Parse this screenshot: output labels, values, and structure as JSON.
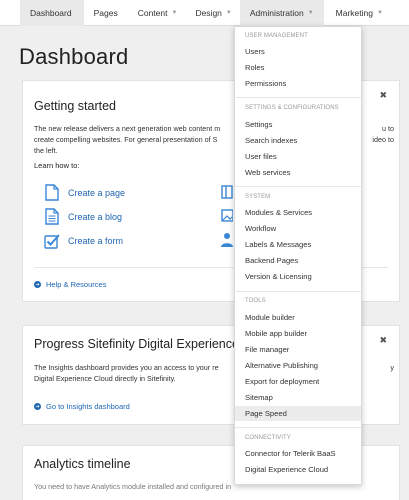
{
  "nav": {
    "dashboard": "Dashboard",
    "pages": "Pages",
    "content": "Content",
    "design": "Design",
    "administration": "Administration",
    "marketing": "Marketing"
  },
  "page_title": "Dashboard",
  "getting_started": {
    "title": "Getting started",
    "description": "The new release delivers a next generation web content m... you to create compelling websites. For general presentation of S... video to the left.",
    "desc_line1": "The new release delivers a next generation web content m",
    "desc_line1_end": "u to",
    "desc_line2": "create compelling websites. For general presentation of S",
    "desc_line2_end": "ideo to",
    "desc_line3": "the left.",
    "learn_how": "Learn how to:",
    "links": [
      "Create a page",
      "Create a blog",
      "Create a form"
    ],
    "help": "Help & Resources"
  },
  "progress": {
    "title": "Progress Sitefinity Digital Experience Clou",
    "desc_line1": "The Insights dashboard provides you an access to your re",
    "desc_line1_end": "y",
    "desc_line2": "Digital Experience Cloud directly in Sitefinity.",
    "link": "Go to Insights dashboard"
  },
  "analytics": {
    "title": "Analytics timeline",
    "desc": "You need to have Analytics module installed and configured in"
  },
  "admin_menu": {
    "user_management": {
      "heading": "USER MANAGEMENT",
      "items": [
        "Users",
        "Roles",
        "Permissions"
      ]
    },
    "settings": {
      "heading": "SETTINGS & CONFIGURATIONS",
      "items": [
        "Settings",
        "Search indexes",
        "User files",
        "Web services"
      ]
    },
    "system": {
      "heading": "SYSTEM",
      "items": [
        "Modules & Services",
        "Workflow",
        "Labels & Messages",
        "Backend Pages",
        "Version & Licensing"
      ]
    },
    "tools": {
      "heading": "TOOLS",
      "items": [
        "Module builder",
        "Mobile app builder",
        "File manager",
        "Alternative Publishing",
        "Export for deployment",
        "Sitemap",
        "Page Speed"
      ]
    },
    "connectivity": {
      "heading": "CONNECTIVITY",
      "items": [
        "Connector for Telerik BaaS",
        "Digital Experience Cloud"
      ]
    },
    "highlighted": "Page Speed"
  },
  "colors": {
    "link": "#1f65b0",
    "icon": "#3a86d6",
    "nav_active_bg": "#e9e9e9",
    "page_bg": "#efefef"
  }
}
